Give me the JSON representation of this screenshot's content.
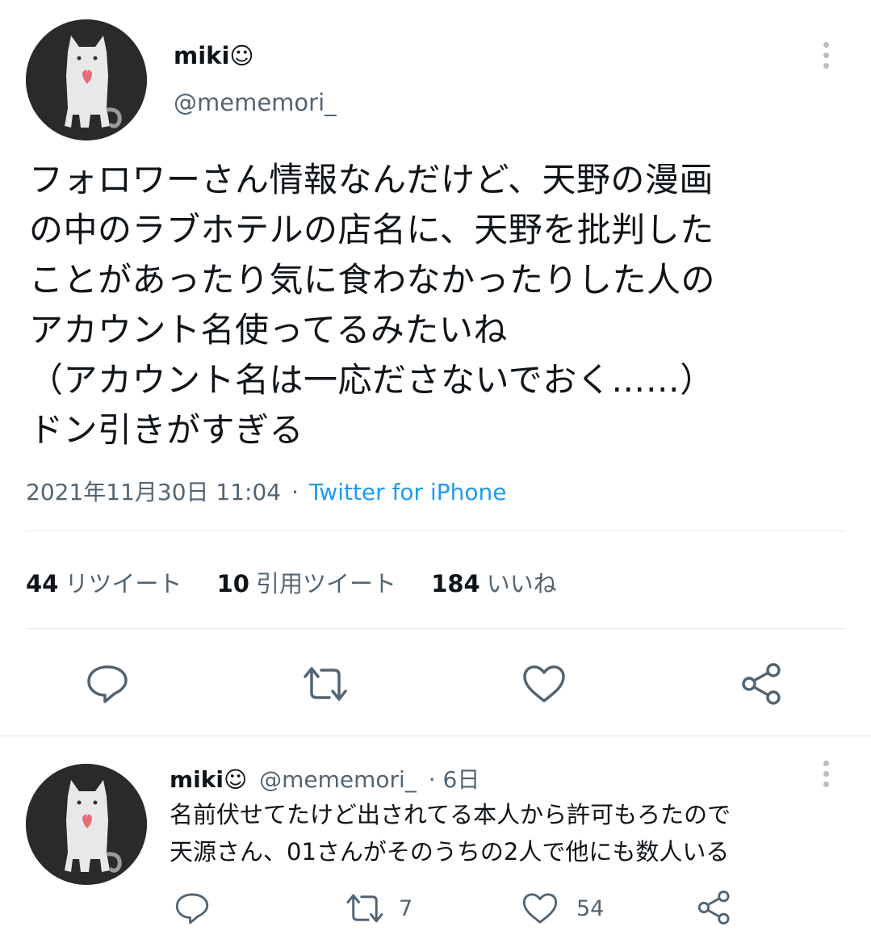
{
  "tweet": {
    "author": {
      "display_name": "miki☺",
      "handle": "@mememori_"
    },
    "text": "フォロワーさん情報なんだけど、天野の漫画\nの中のラブホテルの店名に、天野を批判した\nことがあったり気に食わなかったりした人の\nアカウント名使ってるみたいね\n（アカウント名は一応ださないでおく……）\nドン引きがすぎる",
    "timestamp": "2021年11月30日 11:04",
    "separator": "·",
    "source": "Twitter for iPhone",
    "stats": {
      "retweets": {
        "count": "44",
        "label": "リツイート"
      },
      "quotes": {
        "count": "10",
        "label": "引用ツイート"
      },
      "likes": {
        "count": "184",
        "label": "いいね"
      }
    },
    "actions": [
      "reply-icon",
      "retweet-icon",
      "like-icon",
      "share-icon"
    ]
  },
  "reply": {
    "author": {
      "display_name": "miki☺",
      "handle": "@mememori_"
    },
    "age": "· 6日",
    "text": "名前伏せてたけど出されてる本人から許可もろたので\n天源さん、01さんがそのうちの2人で他にも数人いる",
    "retweet_count": "7",
    "like_count": "54",
    "actions": [
      "reply-icon",
      "retweet-icon",
      "like-icon",
      "share-icon"
    ]
  },
  "colors": {
    "text": "#0f1419",
    "muted": "#536471",
    "link": "#1d9bf0",
    "divider": "#e6e8ea",
    "avatar_bg": "#2a2a2a"
  }
}
